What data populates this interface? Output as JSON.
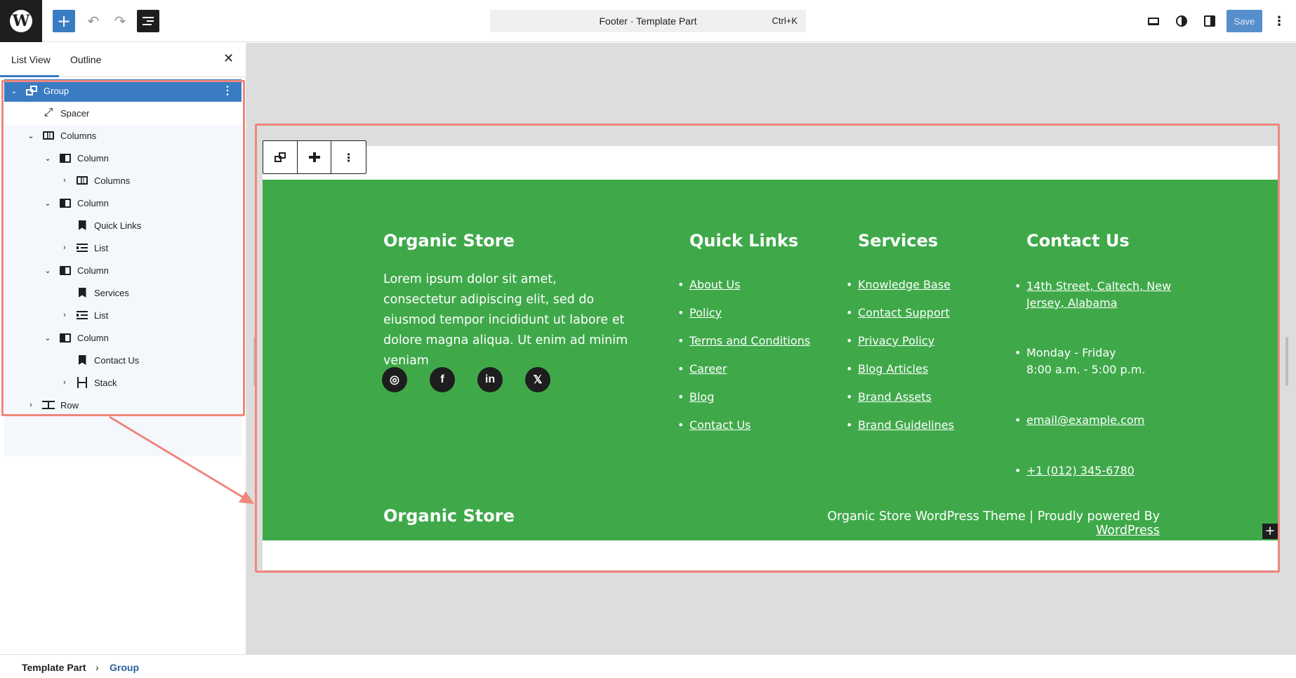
{
  "topbar": {
    "logo": "W",
    "add_icon": "+",
    "undo_icon": "↶",
    "redo_icon": "↷",
    "document_title": "Footer · Template Part",
    "shortcut": "Ctrl+K",
    "save_label": "Save",
    "more_icon": "⋮",
    "accent_color": "#3a7cc4"
  },
  "sidebar": {
    "tabs": [
      "List View",
      "Outline"
    ],
    "close_icon": "✕",
    "tree": [
      {
        "label": "Group",
        "icon": "group-icon",
        "chev": "⌄",
        "selected": true,
        "options": "⋮"
      },
      {
        "label": "Spacer",
        "icon": "spacer-icon"
      },
      {
        "label": "Columns",
        "icon": "columns-icon",
        "chev": "⌄"
      },
      {
        "label": "Column",
        "icon": "column-icon",
        "chev": "⌄"
      },
      {
        "label": "Columns",
        "icon": "columns-icon",
        "chev": "›"
      },
      {
        "label": "Column",
        "icon": "column-icon",
        "chev": "⌄"
      },
      {
        "label": "Quick Links",
        "icon": "heading-icon"
      },
      {
        "label": "List",
        "icon": "list-icon",
        "chev": "›"
      },
      {
        "label": "Column",
        "icon": "column-icon",
        "chev": "⌄"
      },
      {
        "label": "Services",
        "icon": "heading-icon"
      },
      {
        "label": "List",
        "icon": "list-icon",
        "chev": "›"
      },
      {
        "label": "Column",
        "icon": "column-icon",
        "chev": "⌄"
      },
      {
        "label": "Contact Us",
        "icon": "heading-icon"
      },
      {
        "label": "Stack",
        "icon": "stack-icon",
        "chev": "›"
      },
      {
        "label": "Row",
        "icon": "row-icon",
        "chev": "›"
      }
    ]
  },
  "block_toolbar": {
    "more": "⋮"
  },
  "footer": {
    "brand": "Organic Store",
    "description": "Lorem ipsum dolor sit amet, consectetur adipiscing elit, sed do eiusmod tempor incididunt ut labore et dolore magna aliqua. Ut enim ad minim veniam",
    "social": [
      "instagram-icon",
      "facebook-icon",
      "linkedin-icon",
      "x-icon"
    ],
    "social_glyphs": [
      "◎",
      "f",
      "in",
      "𝕏"
    ],
    "quick_links_title": "Quick Links",
    "quick_links": [
      "About Us",
      "Policy",
      "Terms and Conditions",
      "Career",
      "Blog",
      "Contact Us"
    ],
    "services_title": "Services",
    "services": [
      "Knowledge Base",
      "Contact Support",
      "Privacy Policy",
      "Blog Articles",
      "Brand Assets",
      "Brand Guidelines"
    ],
    "contact_title": "Contact Us",
    "contact_address_line1": "14th Street, Caltech, New ",
    "contact_address_line2": "Jersey, Alabama",
    "contact_hours_line1": "Monday - Friday",
    "contact_hours_line2": "8:00 a.m. - 5:00 p.m.",
    "contact_email": "email@example.com",
    "contact_phone": "+1 (012) 345-6780",
    "bottom_brand": "Organic Store",
    "credit_text": "Organic Store WordPress Theme | Proudly powered By ",
    "credit_link": "WordPress",
    "green": "#3fa94a"
  },
  "add_block_icon": "+",
  "breadcrumb": {
    "items": [
      "Template Part",
      "Group"
    ],
    "separator": "›"
  }
}
